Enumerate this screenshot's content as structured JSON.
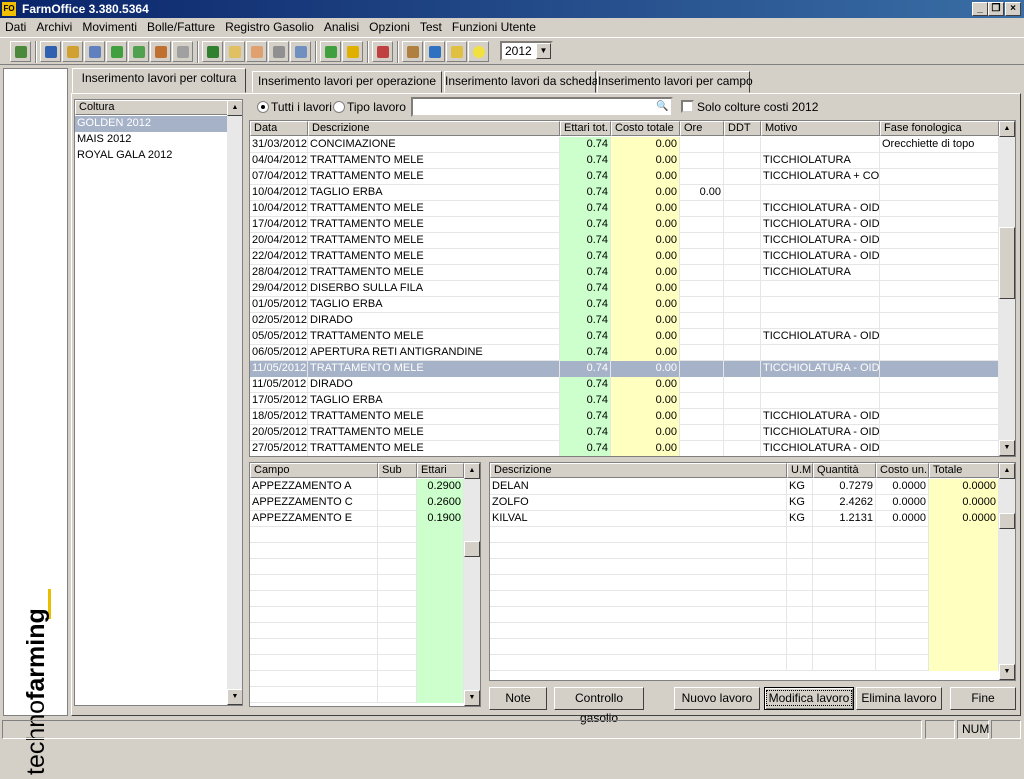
{
  "window": {
    "title": "FarmOffice 3.380.5364",
    "icon_text": "FO"
  },
  "menu": [
    "Dati",
    "Archivi",
    "Movimenti",
    "Bolle/Fatture",
    "Registro Gasolio",
    "Analisi",
    "Opzioni",
    "Test",
    "Funzioni Utente"
  ],
  "toolbar": {
    "year": "2012"
  },
  "logo": {
    "text_light": "techno",
    "text_bold": "farming"
  },
  "tabs": [
    {
      "label": "Inserimento lavori per coltura",
      "active": true
    },
    {
      "label": "Inserimento lavori per operazione",
      "active": false
    },
    {
      "label": "Inserimento lavori da scheda",
      "active": false
    },
    {
      "label": "Inserimento lavori per campo",
      "active": false
    }
  ],
  "crops": {
    "header": "Coltura",
    "items": [
      "GOLDEN 2012",
      "MAIS 2012",
      "ROYAL GALA 2012"
    ],
    "selected": 0
  },
  "filters": {
    "all_label": "Tutti i lavori",
    "type_label": "Tipo lavoro",
    "search_value": "",
    "costs_label": "Solo colture costi 2012"
  },
  "works": {
    "headers": [
      "Data",
      "Descrizione",
      "Ettari tot.",
      "Costo totale",
      "Ore",
      "DDT",
      "Motivo",
      "Fase fonologica"
    ],
    "rows": [
      [
        "31/03/2012",
        "CONCIMAZIONE",
        "0.74",
        "0.00",
        "",
        "",
        "",
        "Orecchiette di topo"
      ],
      [
        "04/04/2012",
        "TRATTAMENTO MELE",
        "0.74",
        "0.00",
        "",
        "",
        "TICCHIOLATURA",
        ""
      ],
      [
        "07/04/2012",
        "TRATTAMENTO MELE",
        "0.74",
        "0.00",
        "",
        "",
        "TICCHIOLATURA + COC",
        ""
      ],
      [
        "10/04/2012",
        "TAGLIO ERBA",
        "0.74",
        "0.00",
        "0.00",
        "",
        "",
        ""
      ],
      [
        "10/04/2012",
        "TRATTAMENTO MELE",
        "0.74",
        "0.00",
        "",
        "",
        "TICCHIOLATURA - OIDIC",
        ""
      ],
      [
        "17/04/2012",
        "TRATTAMENTO MELE",
        "0.74",
        "0.00",
        "",
        "",
        "TICCHIOLATURA - OIDIC",
        ""
      ],
      [
        "20/04/2012",
        "TRATTAMENTO MELE",
        "0.74",
        "0.00",
        "",
        "",
        "TICCHIOLATURA - OIDIC",
        ""
      ],
      [
        "22/04/2012",
        "TRATTAMENTO MELE",
        "0.74",
        "0.00",
        "",
        "",
        "TICCHIOLATURA - OIDIC",
        ""
      ],
      [
        "28/04/2012",
        "TRATTAMENTO MELE",
        "0.74",
        "0.00",
        "",
        "",
        "TICCHIOLATURA",
        ""
      ],
      [
        "29/04/2012",
        "DISERBO SULLA FILA",
        "0.74",
        "0.00",
        "",
        "",
        "",
        ""
      ],
      [
        "01/05/2012",
        "TAGLIO ERBA",
        "0.74",
        "0.00",
        "",
        "",
        "",
        ""
      ],
      [
        "02/05/2012",
        "DIRADO",
        "0.74",
        "0.00",
        "",
        "",
        "",
        ""
      ],
      [
        "05/05/2012",
        "TRATTAMENTO MELE",
        "0.74",
        "0.00",
        "",
        "",
        "TICCHIOLATURA - OIDIC",
        ""
      ],
      [
        "06/05/2012",
        "APERTURA RETI ANTIGRANDINE",
        "0.74",
        "0.00",
        "",
        "",
        "",
        ""
      ],
      [
        "11/05/2012",
        "TRATTAMENTO MELE",
        "0.74",
        "0.00",
        "",
        "",
        "TICCHIOLATURA - OIDIC",
        ""
      ],
      [
        "11/05/2012",
        "DIRADO",
        "0.74",
        "0.00",
        "",
        "",
        "",
        ""
      ],
      [
        "17/05/2012",
        "TAGLIO ERBA",
        "0.74",
        "0.00",
        "",
        "",
        "",
        ""
      ],
      [
        "18/05/2012",
        "TRATTAMENTO MELE",
        "0.74",
        "0.00",
        "",
        "",
        "TICCHIOLATURA - OIDIC",
        ""
      ],
      [
        "20/05/2012",
        "TRATTAMENTO MELE",
        "0.74",
        "0.00",
        "",
        "",
        "TICCHIOLATURA - OIDIC",
        ""
      ],
      [
        "27/05/2012",
        "TRATTAMENTO MELE",
        "0.74",
        "0.00",
        "",
        "",
        "TICCHIOLATURA - OIDIC",
        ""
      ]
    ],
    "selected": 14
  },
  "fields": {
    "headers": [
      "Campo",
      "Sub",
      "Ettari"
    ],
    "rows": [
      [
        "APPEZZAMENTO A",
        "",
        "0.2900"
      ],
      [
        "APPEZZAMENTO C",
        "",
        "0.2600"
      ],
      [
        "APPEZZAMENTO E",
        "",
        "0.1900"
      ]
    ]
  },
  "products": {
    "headers": [
      "Descrizione",
      "U.M.",
      "Quantità",
      "Costo un.",
      "Totale"
    ],
    "rows": [
      [
        "DELAN",
        "KG",
        "0.7279",
        "0.0000",
        "0.0000"
      ],
      [
        "ZOLFO",
        "KG",
        "2.4262",
        "0.0000",
        "0.0000"
      ],
      [
        "KILVAL",
        "KG",
        "1.2131",
        "0.0000",
        "0.0000"
      ]
    ]
  },
  "buttons": {
    "note": "Note",
    "fuel": "Controllo gasolio",
    "new": "Nuovo lavoro",
    "edit": "Modifica lavoro",
    "delete": "Elimina lavoro",
    "end": "Fine"
  },
  "status": {
    "num": "NUM"
  }
}
